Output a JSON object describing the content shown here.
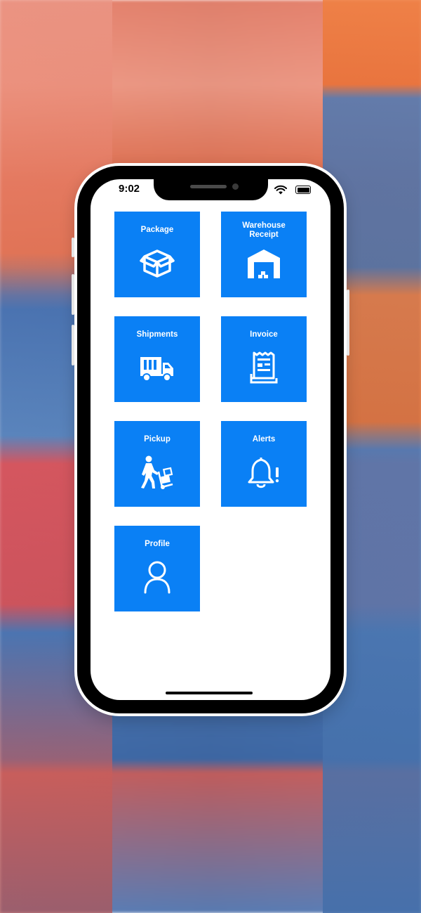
{
  "status_bar": {
    "time": "9:02"
  },
  "colors": {
    "tile": "#0a80f5",
    "tile_text": "#ffffff",
    "screen_bg": "#ffffff"
  },
  "tiles": [
    {
      "label": "Package",
      "icon": "package-box-icon"
    },
    {
      "label": "Warehouse Receipt",
      "icon": "warehouse-icon"
    },
    {
      "label": "Shipments",
      "icon": "truck-icon"
    },
    {
      "label": "Invoice",
      "icon": "receipt-icon"
    },
    {
      "label": "Pickup",
      "icon": "hand-truck-icon"
    },
    {
      "label": "Alerts",
      "icon": "bell-alert-icon"
    },
    {
      "label": "Profile",
      "icon": "user-icon"
    }
  ]
}
